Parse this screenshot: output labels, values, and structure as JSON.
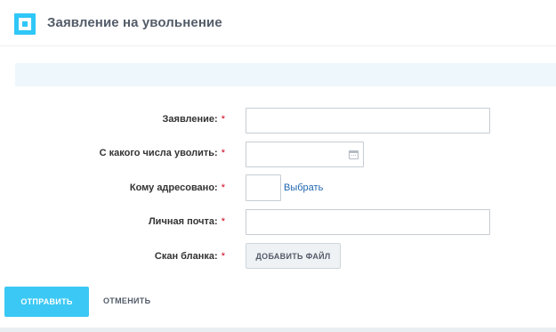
{
  "header": {
    "title": "Заявление на увольнение",
    "logo_icon": "square-frame-logo-icon",
    "accent_color": "#2fc7f7"
  },
  "form": {
    "fields": [
      {
        "label": "Заявление:",
        "required_mark": "*",
        "value": ""
      },
      {
        "label": "С какого числа уволить:",
        "required_mark": "*",
        "value": "",
        "icon": "calendar-icon"
      },
      {
        "label": "Кому адресовано:",
        "required_mark": "*",
        "value": "",
        "link": "Выбрать"
      },
      {
        "label": "Личная почта:",
        "required_mark": "*",
        "value": ""
      },
      {
        "label": "Скан бланка:",
        "required_mark": "*",
        "button": "ДОБАВИТЬ ФАЙЛ"
      }
    ]
  },
  "actions": {
    "submit": "ОТПРАВИТЬ",
    "cancel": "ОТМЕНИТЬ",
    "submit_color": "#3bc8f5"
  }
}
